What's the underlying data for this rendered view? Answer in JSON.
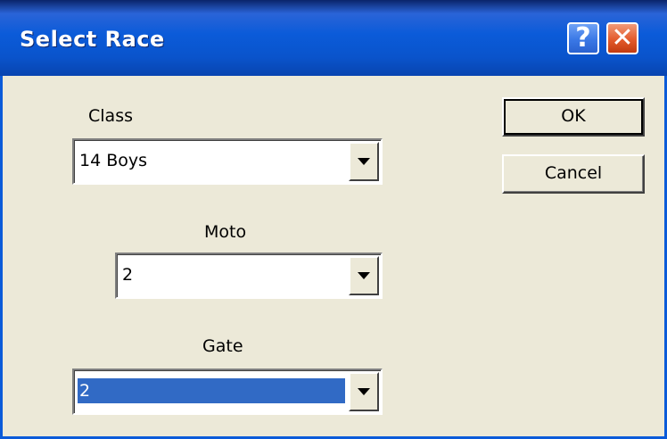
{
  "window": {
    "title": "Select Race",
    "help_glyph": "?",
    "close_glyph": "✕"
  },
  "fields": {
    "class": {
      "label": "Class",
      "value": "14 Boys"
    },
    "moto": {
      "label": "Moto",
      "value": "2"
    },
    "gate": {
      "label": "Gate",
      "value": "2"
    }
  },
  "buttons": {
    "ok": "OK",
    "cancel": "Cancel"
  },
  "colors": {
    "titlebar": "#0b5bd9",
    "face": "#ece9d8",
    "selection": "#316ac5",
    "close": "#e35a2c"
  },
  "icons": [
    "help-icon",
    "close-icon",
    "chevron-down-icon"
  ]
}
